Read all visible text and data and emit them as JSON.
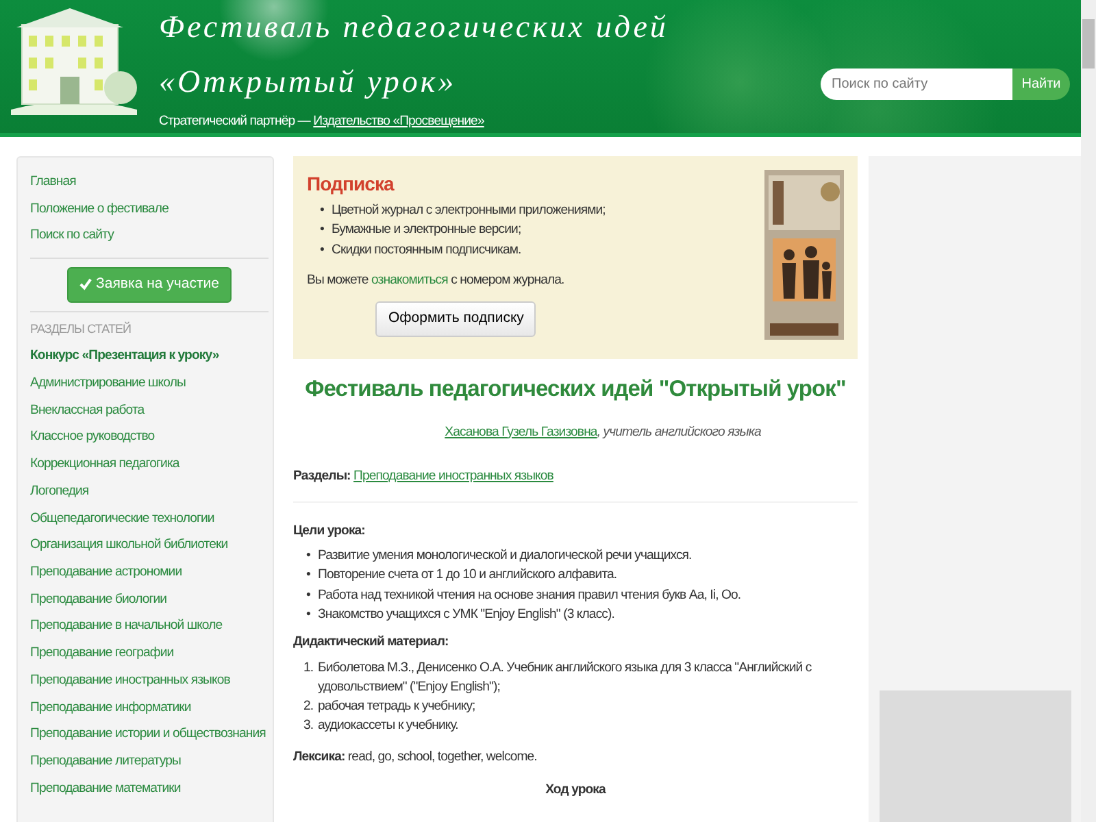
{
  "header": {
    "title_lines": [
      "Фестиваль педагогических идей",
      "«Открытый урок»"
    ],
    "partner_label": "Стратегический партнёр —",
    "partner_link": "Издательство «Просвещение»",
    "search": {
      "placeholder": "Поиск по сайту",
      "button": "Найти"
    }
  },
  "sidebar": {
    "links": [
      "Главная",
      "Положение о фестивале",
      "Поиск по сайту"
    ],
    "apply_button": "Заявка на участие",
    "section_heading": "РАЗДЕЛЫ СТАТЕЙ",
    "sections": [
      {
        "label": "Конкурс «Презентация к уроку»",
        "kind": "featured"
      },
      {
        "label": "Администрирование школы",
        "kind": "plain"
      },
      {
        "label": "Внеклассная работа",
        "kind": "plain"
      },
      {
        "label": "Классное руководство",
        "kind": "plain"
      },
      {
        "label": "Коррекционная педагогика",
        "kind": "plain"
      },
      {
        "label": "Логопедия",
        "kind": "plain"
      },
      {
        "label": "Общепедагогические технологии",
        "kind": "plain"
      },
      {
        "label": "Организация школьной библиотеки",
        "kind": "plain"
      },
      {
        "label": "Преподавание астрономии",
        "kind": "plain"
      },
      {
        "label": "Преподавание биологии",
        "kind": "plain"
      },
      {
        "label": "Преподавание в начальной школе",
        "kind": "plain"
      },
      {
        "label": "Преподавание географии",
        "kind": "plain"
      },
      {
        "label": "Преподавание иностранных языков",
        "kind": "plain"
      },
      {
        "label": "Преподавание информатики",
        "kind": "plain"
      },
      {
        "label": "Преподавание истории и обществознания",
        "kind": "plain"
      },
      {
        "label": "Преподавание литературы",
        "kind": "plain"
      },
      {
        "label": "Преподавание математики",
        "kind": "plain"
      }
    ]
  },
  "subscription": {
    "title": "Подписка",
    "items": [
      {
        "marker": "•",
        "text": "Цветной журнал с электронными приложениями;"
      },
      {
        "marker": "•",
        "text": "Бумажные и электронные версии;"
      },
      {
        "marker": "•",
        "text": "Скидки постоянным подписчикам."
      }
    ],
    "note_before": "Вы можете",
    "note_link": "ознакомиться",
    "note_after": "с номером журнала.",
    "button": "Оформить подписку"
  },
  "article": {
    "title": "Фестиваль педагогических идей \"Открытый урок\"",
    "author": {
      "name": "Хасанова Гузель Газизовна",
      "role": ", учитель английского языка"
    },
    "sections_label": "Разделы:",
    "section_link": "Преподавание иностранных языков",
    "blocks": [
      {
        "kind": "heading",
        "text": "Цели урока:"
      },
      {
        "kind": "list",
        "items": [
          {
            "marker": "•",
            "text": "Развитие умения монологической и диалогической речи учащихся."
          },
          {
            "marker": "•",
            "text": "Повторение счета от 1 до 10 и английского алфавита."
          },
          {
            "marker": "•",
            "text": "Работа над техникой чтения на основе знания правил чтения букв Aa, Ii, Oo."
          },
          {
            "marker": "•",
            "text": "Знакомство учащихся с УМК \"Enjoy English\" (3 класс)."
          }
        ]
      },
      {
        "kind": "heading",
        "text": "Дидактический материал:"
      },
      {
        "kind": "list",
        "items": [
          {
            "marker": "1.",
            "text": "Биболетова М.З., Денисенко О.А. Учебник английского языка для 3 класса \"Английский с удовольствием\" (\"Enjoy English\");"
          },
          {
            "marker": "2.",
            "text": "рабочая тетрадь к учебнику;"
          },
          {
            "marker": "3.",
            "text": "аудиокассеты к учебнику."
          }
        ]
      },
      {
        "kind": "paragraph",
        "text": "**Лексика:** read, go, school, together, welcome."
      },
      {
        "kind": "center_heading",
        "text": "Ход урока"
      }
    ]
  }
}
